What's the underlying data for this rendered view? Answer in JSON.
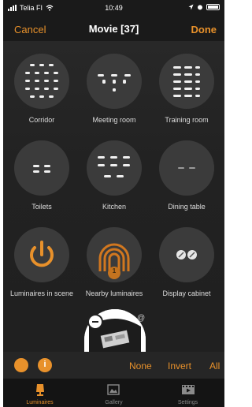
{
  "status_bar": {
    "carrier": "Telia FI",
    "time": "10:49",
    "icons": [
      "signal-bars-icon",
      "wifi-icon",
      "location-icon",
      "alarm-icon",
      "battery-icon"
    ]
  },
  "nav": {
    "cancel_label": "Cancel",
    "title": "Movie [37]",
    "done_label": "Done"
  },
  "tiles": [
    {
      "label": "Corridor",
      "icon": "corridor-luminaires-icon"
    },
    {
      "label": "Meeting room",
      "icon": "meeting-room-luminaires-icon"
    },
    {
      "label": "Training room",
      "icon": "training-room-luminaires-icon"
    },
    {
      "label": "Toilets",
      "icon": "toilets-luminaires-icon"
    },
    {
      "label": "Kitchen",
      "icon": "kitchen-luminaires-icon"
    },
    {
      "label": "Dining table",
      "icon": "dining-table-luminaires-icon"
    },
    {
      "label": "Luminaires in scene",
      "icon": "power-icon"
    },
    {
      "label": "Nearby luminaires",
      "icon": "nearby-signal-icon",
      "badge": "1"
    },
    {
      "label": "Display cabinet",
      "icon": "display-cabinet-luminaires-icon"
    }
  ],
  "preview": {
    "at_symbol": "@"
  },
  "selection": {
    "none_label": "None",
    "invert_label": "Invert",
    "all_label": "All",
    "info_glyph": "i"
  },
  "tabs": [
    {
      "label": "Luminaires",
      "icon": "lamp-icon",
      "active": true
    },
    {
      "label": "Gallery",
      "icon": "gallery-icon",
      "active": false
    },
    {
      "label": "Settings",
      "icon": "settings-icon",
      "active": false
    }
  ],
  "colors": {
    "accent": "#e8912b",
    "background": "#232323",
    "tile_circle": "#3b3b3b",
    "light_dot": "#f0f0f0"
  }
}
